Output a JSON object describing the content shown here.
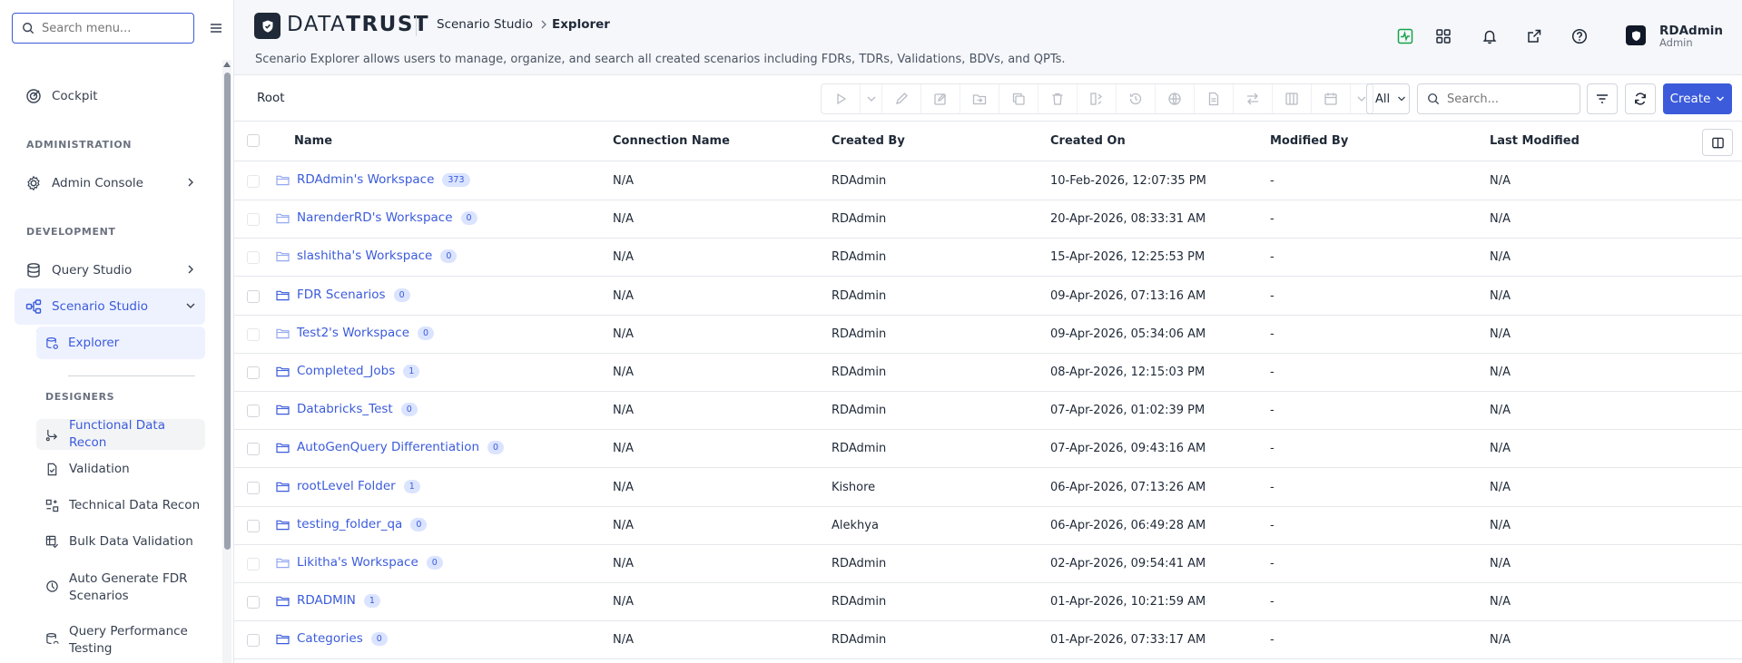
{
  "sidebar": {
    "search_placeholder": "Search menu...",
    "cockpit": "Cockpit",
    "section_admin": "ADMINISTRATION",
    "admin_console": "Admin Console",
    "section_dev": "DEVELOPMENT",
    "query_studio": "Query Studio",
    "scenario_studio": "Scenario Studio",
    "explorer": "Explorer",
    "section_designers": "DESIGNERS",
    "designers": [
      {
        "label": "Functional Data Recon"
      },
      {
        "label": "Validation"
      },
      {
        "label": "Technical Data Recon"
      },
      {
        "label": "Bulk Data Validation"
      },
      {
        "label": "Auto Generate FDR Scenarios"
      },
      {
        "label": "Query Performance Testing"
      }
    ]
  },
  "header": {
    "logo_a": "DATA",
    "logo_b": "TRUST",
    "crumb_1": "Scenario Studio",
    "crumb_2": "Explorer",
    "description": "Scenario Explorer allows users to manage, organize, and search all created scenarios including FDRs, TDRs, Validations, BDVs, and QPTs.",
    "user_name": "RDAdmin",
    "user_role": "Admin"
  },
  "toolbar": {
    "root": "Root",
    "filter_value": "All",
    "search_placeholder": "Search...",
    "create_label": "Create"
  },
  "table": {
    "columns": [
      "Name",
      "Connection Name",
      "Created By",
      "Created On",
      "Modified By",
      "Last Modified"
    ],
    "rows": [
      {
        "name": "RDAdmin's Workspace",
        "count": "373",
        "workspace": true,
        "connection": "N/A",
        "created_by": "RDAdmin",
        "created_on": "10-Feb-2026, 12:07:35 PM",
        "modified_by": "-",
        "last_modified": "N/A"
      },
      {
        "name": "NarenderRD's Workspace",
        "count": "0",
        "workspace": true,
        "connection": "N/A",
        "created_by": "RDAdmin",
        "created_on": "20-Apr-2026, 08:33:31 AM",
        "modified_by": "-",
        "last_modified": "N/A"
      },
      {
        "name": "slashitha's Workspace",
        "count": "0",
        "workspace": true,
        "connection": "N/A",
        "created_by": "RDAdmin",
        "created_on": "15-Apr-2026, 12:25:53 PM",
        "modified_by": "-",
        "last_modified": "N/A"
      },
      {
        "name": "FDR Scenarios",
        "count": "0",
        "workspace": false,
        "connection": "N/A",
        "created_by": "RDAdmin",
        "created_on": "09-Apr-2026, 07:13:16 AM",
        "modified_by": "-",
        "last_modified": "N/A"
      },
      {
        "name": "Test2's Workspace",
        "count": "0",
        "workspace": true,
        "connection": "N/A",
        "created_by": "RDAdmin",
        "created_on": "09-Apr-2026, 05:34:06 AM",
        "modified_by": "-",
        "last_modified": "N/A"
      },
      {
        "name": "Completed_Jobs",
        "count": "1",
        "workspace": false,
        "connection": "N/A",
        "created_by": "RDAdmin",
        "created_on": "08-Apr-2026, 12:15:03 PM",
        "modified_by": "-",
        "last_modified": "N/A"
      },
      {
        "name": "Databricks_Test",
        "count": "0",
        "workspace": false,
        "connection": "N/A",
        "created_by": "RDAdmin",
        "created_on": "07-Apr-2026, 01:02:39 PM",
        "modified_by": "-",
        "last_modified": "N/A"
      },
      {
        "name": "AutoGenQuery Differentiation",
        "count": "0",
        "workspace": false,
        "connection": "N/A",
        "created_by": "RDAdmin",
        "created_on": "07-Apr-2026, 09:43:16 AM",
        "modified_by": "-",
        "last_modified": "N/A"
      },
      {
        "name": "rootLevel Folder",
        "count": "1",
        "workspace": false,
        "connection": "N/A",
        "created_by": "Kishore",
        "created_on": "06-Apr-2026, 07:13:26 AM",
        "modified_by": "-",
        "last_modified": "N/A"
      },
      {
        "name": "testing_folder_qa",
        "count": "0",
        "workspace": false,
        "connection": "N/A",
        "created_by": "Alekhya",
        "created_on": "06-Apr-2026, 06:49:28 AM",
        "modified_by": "-",
        "last_modified": "N/A"
      },
      {
        "name": "Likitha's Workspace",
        "count": "0",
        "workspace": true,
        "connection": "N/A",
        "created_by": "RDAdmin",
        "created_on": "02-Apr-2026, 09:54:41 AM",
        "modified_by": "-",
        "last_modified": "N/A"
      },
      {
        "name": "RDADMIN",
        "count": "1",
        "workspace": false,
        "connection": "N/A",
        "created_by": "RDAdmin",
        "created_on": "01-Apr-2026, 10:21:59 AM",
        "modified_by": "-",
        "last_modified": "N/A"
      },
      {
        "name": "Categories",
        "count": "0",
        "workspace": false,
        "connection": "N/A",
        "created_by": "RDAdmin",
        "created_on": "01-Apr-2026, 07:33:17 AM",
        "modified_by": "-",
        "last_modified": "N/A"
      }
    ]
  },
  "colors": {
    "accent": "#3b5bdb",
    "accent_light": "#eef2ff",
    "text": "#1f2937",
    "muted": "#6b7280",
    "border": "#e5e7eb"
  }
}
